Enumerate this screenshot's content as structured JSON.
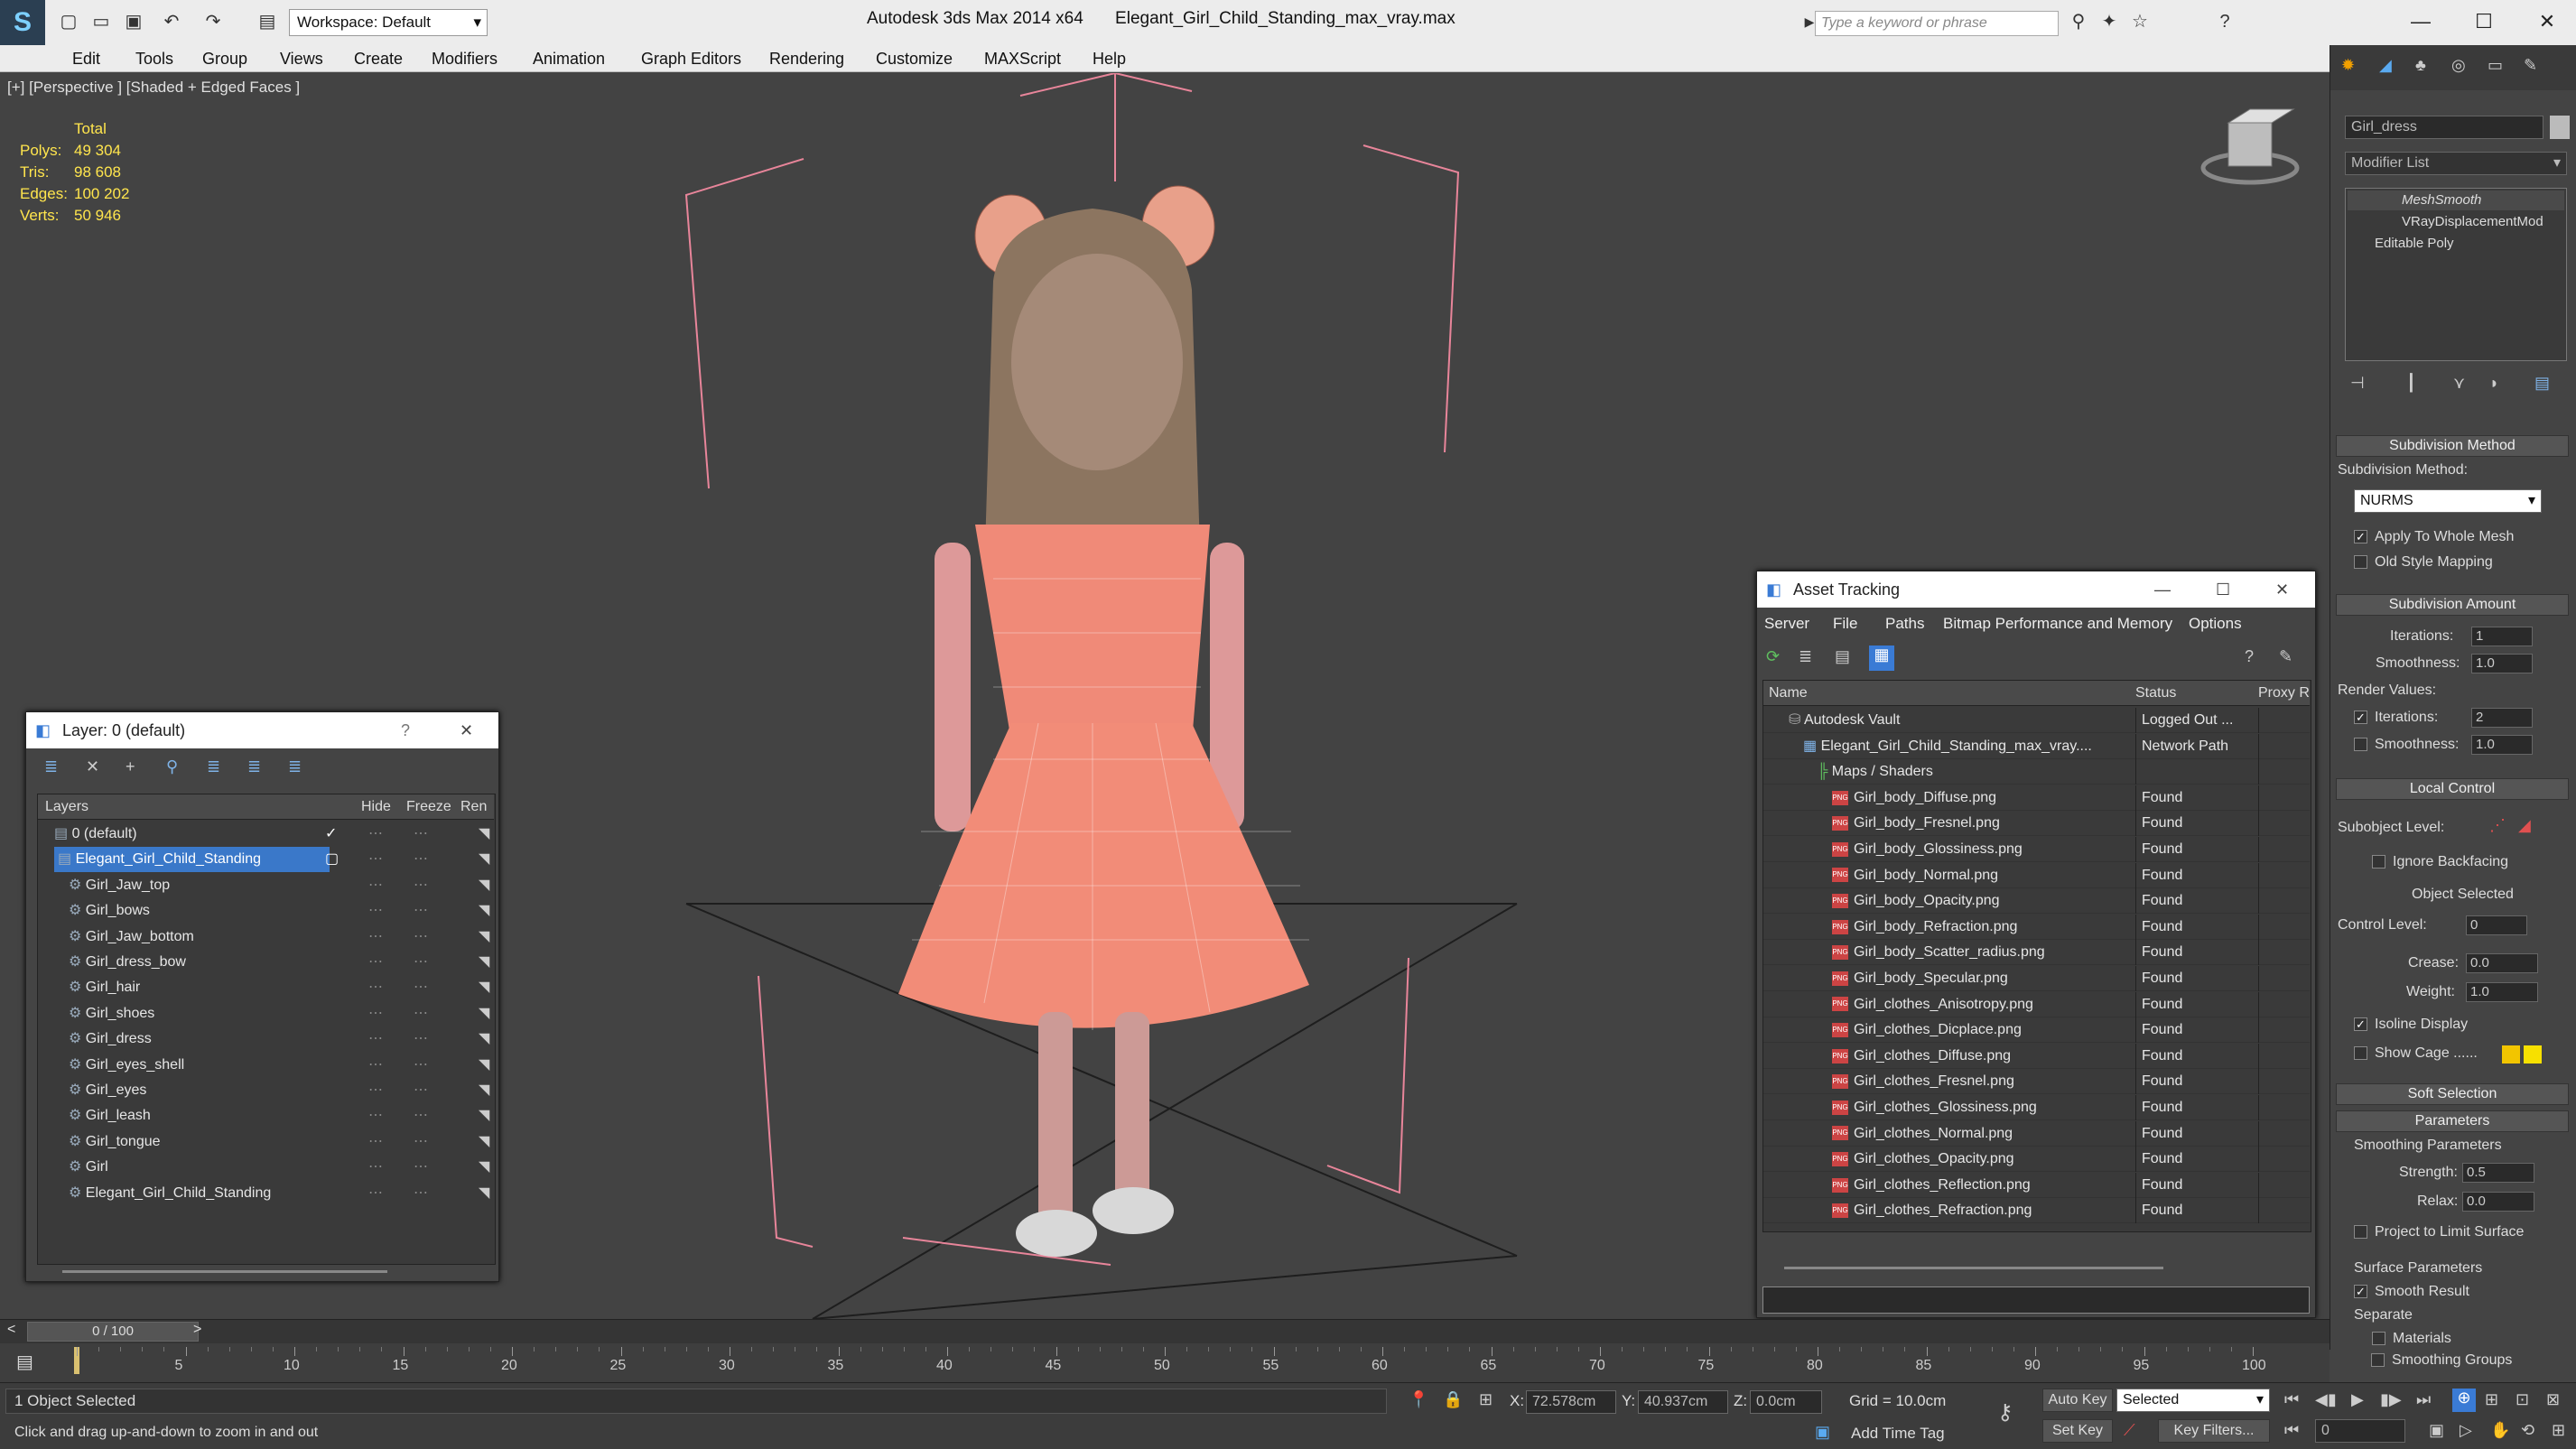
{
  "title": {
    "workspace": "Workspace: Default",
    "app": "Autodesk 3ds Max  2014 x64",
    "file": "Elegant_Girl_Child_Standing_max_vray.max",
    "search_placeholder": "Type a keyword or phrase"
  },
  "menu": [
    "Edit",
    "Tools",
    "Group",
    "Views",
    "Create",
    "Modifiers",
    "Animation",
    "Graph Editors",
    "Rendering",
    "Customize",
    "MAXScript",
    "Help"
  ],
  "viewport": {
    "label": "[+] [Perspective ] [Shaded + Edged Faces ]",
    "stats": {
      "total_label": "Total",
      "rows": [
        {
          "k": "Polys:",
          "v": "49 304"
        },
        {
          "k": "Tris:",
          "v": "98 608"
        },
        {
          "k": "Edges:",
          "v": "100 202"
        },
        {
          "k": "Verts:",
          "v": "50 946"
        }
      ]
    }
  },
  "right_panel": {
    "object_name": "Girl_dress",
    "modifier_list": "Modifier List",
    "stack": [
      "MeshSmooth",
      "VRayDisplacementMod",
      "Editable Poly"
    ],
    "subdivision_method_header": "Subdivision Method",
    "subdivision_method_label": "Subdivision Method:",
    "subdivision_method_value": "NURMS",
    "apply_whole_mesh": "Apply To Whole Mesh",
    "old_style_mapping": "Old Style Mapping",
    "subdivision_amount_header": "Subdivision Amount",
    "iterations_label": "Iterations:",
    "iterations_value": "1",
    "smoothness_label": "Smoothness:",
    "smoothness_value": "1.0",
    "render_values": "Render Values:",
    "render_iterations_label": "Iterations:",
    "render_iterations_value": "2",
    "render_smoothness_label": "Smoothness:",
    "render_smoothness_value": "1.0",
    "local_control_header": "Local Control",
    "subobject_level": "Subobject Level:",
    "ignore_backfacing": "Ignore Backfacing",
    "object_selected": "Object Selected",
    "control_level_label": "Control Level:",
    "control_level_value": "0",
    "crease_label": "Crease:",
    "crease_value": "0.0",
    "weight_label": "Weight:",
    "weight_value": "1.0",
    "isoline_display": "Isoline Display",
    "show_cage": "Show Cage ......",
    "soft_selection_header": "Soft Selection",
    "parameters_header": "Parameters",
    "smoothing_parameters": "Smoothing Parameters",
    "strength_label": "Strength:",
    "strength_value": "0.5",
    "relax_label": "Relax:",
    "relax_value": "0.0",
    "project_limit": "Project to Limit Surface",
    "surface_parameters": "Surface Parameters",
    "smooth_result": "Smooth Result",
    "separate": "Separate",
    "materials": "Materials",
    "smoothing_groups": "Smoothing Groups",
    "cage_color1": "#f2c500",
    "cage_color2": "#f7e000"
  },
  "layer_window": {
    "title": "Layer: 0 (default)",
    "cols": [
      "Layers",
      "Hide",
      "Freeze",
      "Ren"
    ],
    "rows": [
      {
        "name": "0 (default)",
        "indent": 1,
        "selected": false,
        "check": true
      },
      {
        "name": "Elegant_Girl_Child_Standing",
        "indent": 1,
        "selected": true,
        "check": false
      },
      {
        "name": "Girl_Jaw_top",
        "indent": 2
      },
      {
        "name": "Girl_bows",
        "indent": 2
      },
      {
        "name": "Girl_Jaw_bottom",
        "indent": 2
      },
      {
        "name": "Girl_dress_bow",
        "indent": 2
      },
      {
        "name": "Girl_hair",
        "indent": 2
      },
      {
        "name": "Girl_shoes",
        "indent": 2
      },
      {
        "name": "Girl_dress",
        "indent": 2
      },
      {
        "name": "Girl_eyes_shell",
        "indent": 2
      },
      {
        "name": "Girl_eyes",
        "indent": 2
      },
      {
        "name": "Girl_leash",
        "indent": 2
      },
      {
        "name": "Girl_tongue",
        "indent": 2
      },
      {
        "name": "Girl",
        "indent": 2
      },
      {
        "name": "Elegant_Girl_Child_Standing",
        "indent": 2
      }
    ]
  },
  "asset_window": {
    "title": "Asset Tracking",
    "menu": [
      "Server",
      "File",
      "Paths",
      "Bitmap Performance and Memory",
      "Options"
    ],
    "cols": [
      "Name",
      "Status",
      "Proxy R"
    ],
    "rows": [
      {
        "name": "Autodesk Vault",
        "status": "Logged Out ...",
        "indent": 1,
        "kind": "vault"
      },
      {
        "name": "Elegant_Girl_Child_Standing_max_vray....",
        "status": "Network Path",
        "indent": 2,
        "kind": "file"
      },
      {
        "name": "Maps / Shaders",
        "status": "",
        "indent": 3,
        "kind": "folder"
      },
      {
        "name": "Girl_body_Diffuse.png",
        "status": "Found",
        "indent": 4,
        "kind": "png"
      },
      {
        "name": "Girl_body_Fresnel.png",
        "status": "Found",
        "indent": 4,
        "kind": "png"
      },
      {
        "name": "Girl_body_Glossiness.png",
        "status": "Found",
        "indent": 4,
        "kind": "png"
      },
      {
        "name": "Girl_body_Normal.png",
        "status": "Found",
        "indent": 4,
        "kind": "png"
      },
      {
        "name": "Girl_body_Opacity.png",
        "status": "Found",
        "indent": 4,
        "kind": "png"
      },
      {
        "name": "Girl_body_Refraction.png",
        "status": "Found",
        "indent": 4,
        "kind": "png"
      },
      {
        "name": "Girl_body_Scatter_radius.png",
        "status": "Found",
        "indent": 4,
        "kind": "png"
      },
      {
        "name": "Girl_body_Specular.png",
        "status": "Found",
        "indent": 4,
        "kind": "png"
      },
      {
        "name": "Girl_clothes_Anisotropy.png",
        "status": "Found",
        "indent": 4,
        "kind": "png"
      },
      {
        "name": "Girl_clothes_Dicplace.png",
        "status": "Found",
        "indent": 4,
        "kind": "png"
      },
      {
        "name": "Girl_clothes_Diffuse.png",
        "status": "Found",
        "indent": 4,
        "kind": "png"
      },
      {
        "name": "Girl_clothes_Fresnel.png",
        "status": "Found",
        "indent": 4,
        "kind": "png"
      },
      {
        "name": "Girl_clothes_Glossiness.png",
        "status": "Found",
        "indent": 4,
        "kind": "png"
      },
      {
        "name": "Girl_clothes_Normal.png",
        "status": "Found",
        "indent": 4,
        "kind": "png"
      },
      {
        "name": "Girl_clothes_Opacity.png",
        "status": "Found",
        "indent": 4,
        "kind": "png"
      },
      {
        "name": "Girl_clothes_Reflection.png",
        "status": "Found",
        "indent": 4,
        "kind": "png"
      },
      {
        "name": "Girl_clothes_Refraction.png",
        "status": "Found",
        "indent": 4,
        "kind": "png"
      }
    ]
  },
  "timeline": {
    "frame": "0 / 100",
    "ticks": [
      "0",
      "5",
      "10",
      "15",
      "20",
      "25",
      "30",
      "35",
      "40",
      "45",
      "50",
      "55",
      "60",
      "65",
      "70",
      "75",
      "80",
      "85",
      "90",
      "95",
      "100"
    ]
  },
  "status": {
    "selected": "1 Object Selected",
    "hint": "Click and drag up-and-down to zoom in and out",
    "x_label": "X:",
    "x_value": "72.578cm",
    "y_label": "Y:",
    "y_value": "40.937cm",
    "z_label": "Z:",
    "z_value": "0.0cm",
    "grid": "Grid = 10.0cm",
    "add_time_tag": "Add Time Tag",
    "auto_key": "Auto Key",
    "selected_dropdown": "Selected",
    "set_key": "Set Key",
    "key_filters": "Key Filters...",
    "frame_value": "0"
  },
  "colors": {
    "accent": "#3a7bd5",
    "selection": "#3a78c9",
    "grid_pink": "#e8859a",
    "dress": "#f08a78"
  }
}
